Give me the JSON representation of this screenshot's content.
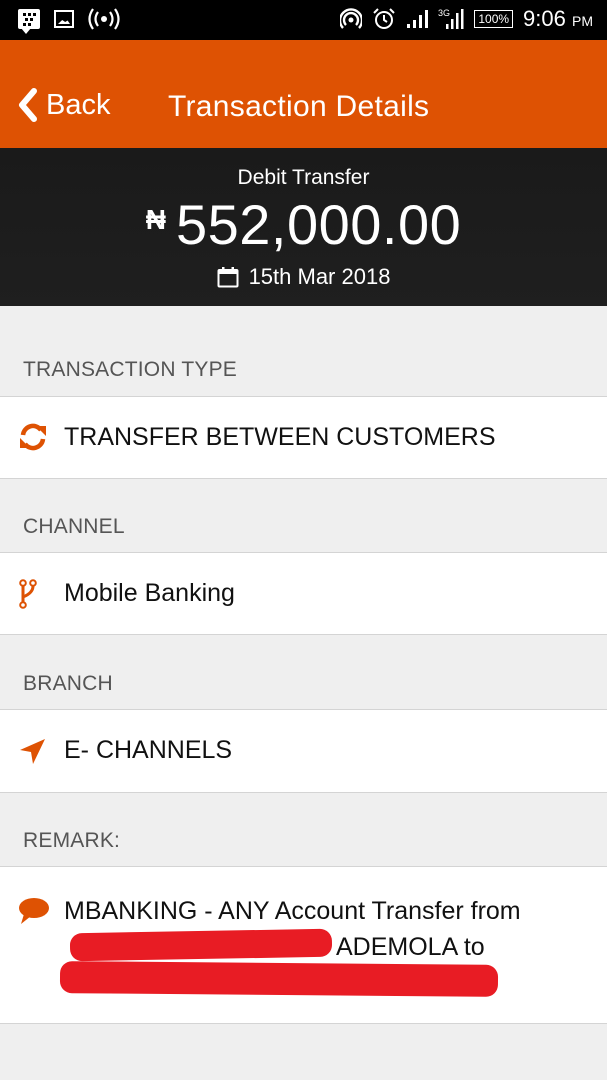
{
  "status_bar": {
    "left_icons": [
      "bbm-icon",
      "gallery-icon",
      "hotspot-icon"
    ],
    "right_icons": [
      "wifi-hotspot-icon",
      "alarm-icon",
      "signal-icon",
      "3g-signal-icon"
    ],
    "battery": "100%",
    "time": "9:06",
    "ampm": "PM"
  },
  "app_bar": {
    "back_label": "Back",
    "title": "Transaction Details"
  },
  "summary": {
    "type": "Debit Transfer",
    "currency_symbol": "₦",
    "amount": "552,000.00",
    "date": "15th Mar 2018"
  },
  "sections": {
    "transaction_type": {
      "label": "TRANSACTION TYPE",
      "value": "TRANSFER BETWEEN CUSTOMERS",
      "icon": "refresh-icon"
    },
    "channel": {
      "label": "CHANNEL",
      "value": "Mobile Banking",
      "icon": "branch-fork-icon"
    },
    "branch": {
      "label": "BRANCH",
      "value": "E- CHANNELS",
      "icon": "location-arrow-icon"
    },
    "remark": {
      "label": "REMARK:",
      "line1": "MBANKING - ANY Account Transfer from",
      "line2_visible": "ADEMOLA to",
      "icon": "comment-icon",
      "redacted": true
    }
  },
  "colors": {
    "accent": "#de5203",
    "header_dark": "#1c1c1c",
    "background": "#efefef",
    "redaction": "#e81c24"
  }
}
